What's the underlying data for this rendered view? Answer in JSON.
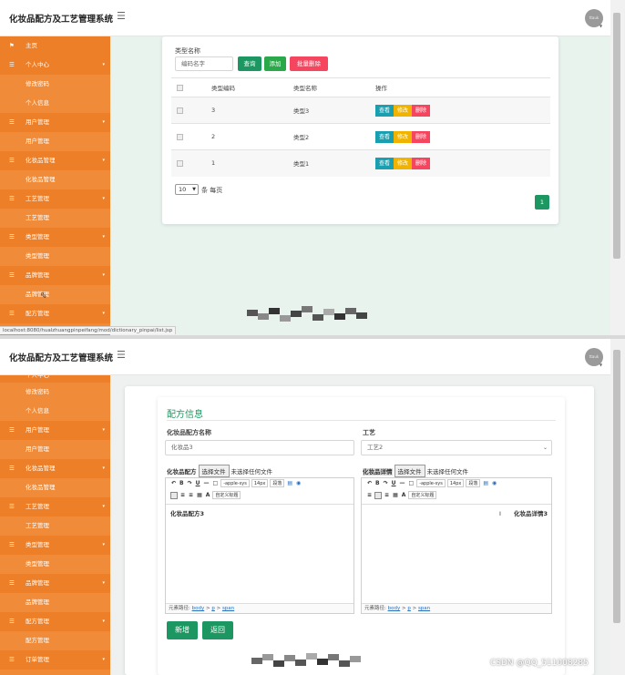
{
  "app": {
    "title": "化妆品配方及工艺管理系统",
    "avatar_text": "ttauk"
  },
  "colors": {
    "sidebar": "#f08a36",
    "primary": "#1c9762",
    "danger": "#f5455f",
    "info": "#1a9fb0",
    "warning": "#f0b400"
  },
  "sidebar": {
    "home": "主页",
    "personal_center": "个人中心",
    "change_password": "修改密码",
    "personal_info": "个人信息",
    "user_mgmt": "用户管理",
    "user_mgmt_child": "用户管理",
    "cosmetic_mgmt": "化妆品管理",
    "cosmetic_mgmt_child": "化妆品管理",
    "process_mgmt": "工艺管理",
    "process_mgmt_child": "工艺管理",
    "type_mgmt": "类型管理",
    "type_mgmt_child": "类型管理",
    "brand_mgmt": "品牌管理",
    "brand_mgmt_child": "品牌管理",
    "formula_mgmt": "配方管理",
    "formula_mgmt_child": "配方管理",
    "order_mgmt": "订单管理"
  },
  "list_page": {
    "search_label": "类型名称",
    "search_placeholder": "编码名字",
    "query_btn": "查询",
    "add_btn": "添加",
    "batch_delete_btn": "批量删除",
    "columns": [
      "类型编码",
      "类型名称",
      "操作"
    ],
    "rows": [
      {
        "code": "3",
        "name": "类型3"
      },
      {
        "code": "2",
        "name": "类型2"
      },
      {
        "code": "1",
        "name": "类型1"
      }
    ],
    "view_btn": "查看",
    "edit_btn": "修改",
    "delete_btn": "删除",
    "page_size": "10",
    "page_size_suffix": "条 每页",
    "current_page": "1",
    "status_url": "localhost:8080/hualzhuangpinpeifang/mod/dictionary_pinpai/list.jsp"
  },
  "form_page": {
    "heading": "配方信息",
    "name_label": "化妆品配方名称",
    "name_value": "化妆品3",
    "process_label": "工艺",
    "process_value": "工艺2",
    "formula_label": "化妆品配方",
    "detail_label": "化妆品详情",
    "choose_file": "选择文件",
    "no_file": "未选择任何文件",
    "font_name": "-apple-sys",
    "font_size": "14px",
    "paragraph": "段落",
    "custom_title": "自定义标题",
    "formula_content": "化妆品配方3",
    "detail_content": "化妆品详情3",
    "path_label": "元素路径:",
    "path_body": "body",
    "path_p": "p",
    "path_span": "span",
    "save_btn": "新增",
    "back_btn": "返回"
  },
  "watermark": "CSDN @QQ_511008285"
}
